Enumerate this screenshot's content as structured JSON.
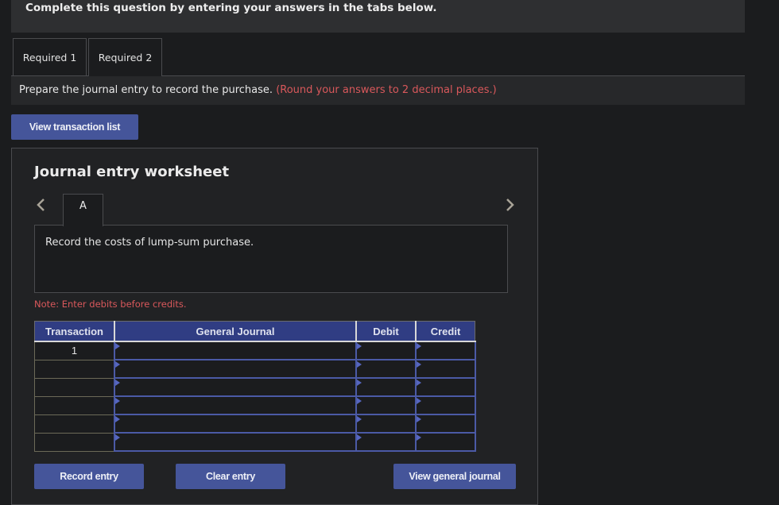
{
  "banner": {
    "text": "Complete this question by entering your answers in the tabs below."
  },
  "tabs": [
    {
      "label": "Required 1",
      "active": false
    },
    {
      "label": "Required 2",
      "active": true
    }
  ],
  "instruction": {
    "text": "Prepare the journal entry to record the purchase.",
    "hint": "(Round your answers to 2 decimal places.)"
  },
  "buttons": {
    "view_transaction_list": "View transaction list",
    "record_entry": "Record entry",
    "clear_entry": "Clear entry",
    "view_general_journal": "View general journal"
  },
  "worksheet": {
    "title": "Journal entry worksheet",
    "prev_icon": "chevron-left-icon",
    "next_icon": "chevron-right-icon",
    "entry_tab": "A",
    "description": "Record the costs of lump-sum purchase.",
    "note": "Note: Enter debits before credits.",
    "table": {
      "headers": [
        "Transaction",
        "General Journal",
        "Debit",
        "Credit"
      ],
      "rows": [
        {
          "transaction": "1",
          "account": "",
          "debit": "",
          "credit": ""
        },
        {
          "transaction": "",
          "account": "",
          "debit": "",
          "credit": ""
        },
        {
          "transaction": "",
          "account": "",
          "debit": "",
          "credit": ""
        },
        {
          "transaction": "",
          "account": "",
          "debit": "",
          "credit": ""
        },
        {
          "transaction": "",
          "account": "",
          "debit": "",
          "credit": ""
        },
        {
          "transaction": "",
          "account": "",
          "debit": "",
          "credit": ""
        }
      ]
    }
  },
  "colors": {
    "accent_button": "#45559a",
    "table_header": "#303d83",
    "warning_text": "#d9585b",
    "background": "#1b1c1e"
  }
}
